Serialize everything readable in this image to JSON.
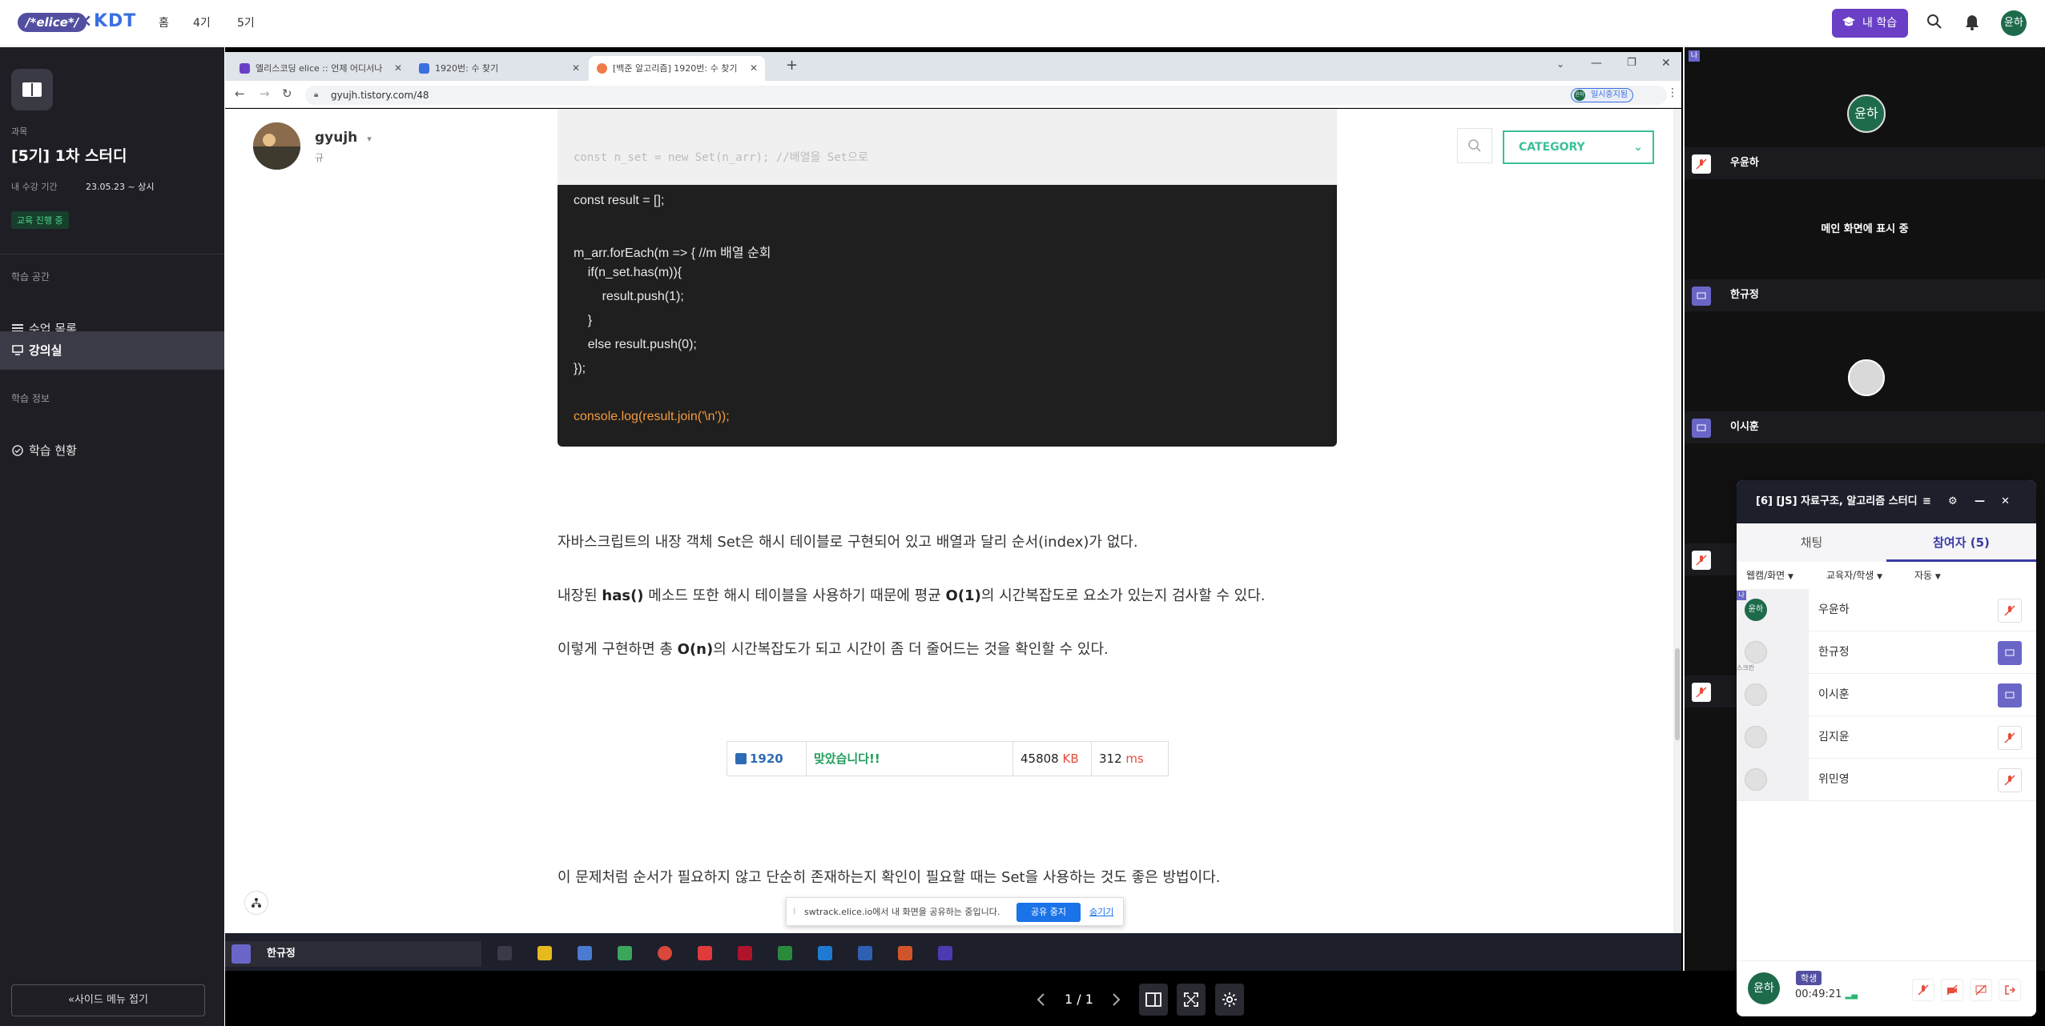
{
  "topbar": {
    "logo_text": "/*elice*/",
    "logo_x": "×",
    "logo_kdt": "KDT",
    "nav": [
      "홈",
      "4기",
      "5기"
    ],
    "my_learning": "내 학습",
    "avatar": "윤하"
  },
  "sidebar": {
    "course_label": "과목",
    "course_title": "[5기] 1차 스터디",
    "period_label": "내 수강 기간",
    "period_value": "23.05.23 ~ 상시",
    "status_badge": "교육 진행 중",
    "section1": "학습 공간",
    "items": [
      {
        "label": "수업 목록"
      },
      {
        "label": "강의실"
      }
    ],
    "section2": "학습 정보",
    "info_items": [
      {
        "label": "학습 현황"
      }
    ],
    "collapse": "«사이드 메뉴 접기"
  },
  "browser": {
    "tabs": [
      {
        "title": "엘리스코딩 elice :: 언제 어디서나",
        "color": "#6a3fc6"
      },
      {
        "title": "1920번: 수 찾기",
        "color": "#3a6fe0"
      },
      {
        "title": "[백준 알고리즘] 1920번: 수 찾기",
        "color": "#f07a4a"
      }
    ],
    "url": "gyujh.tistory.com/48",
    "paused_label": "일시중지됨",
    "profile_initials": "윤하"
  },
  "blog": {
    "author": "gyujh",
    "author_sub": "규",
    "category": "CATEGORY",
    "faded_lines": [
      "const n_set = new Set(n_arr); //배열을 Set으로"
    ],
    "code_lines": [
      "const result = [];",
      "",
      "m_arr.forEach(m => { //m 배열 순회",
      "    if(n_set.has(m)){",
      "        result.push(1);",
      "    }",
      "    else result.push(0);",
      "});",
      "",
      "console.log(result.join('\\n'));"
    ],
    "para1": "자바스크립트의 내장 객체 Set은 해시 테이블로 구현되어 있고 배열과 달리 순서(index)가 없다.",
    "para2_pre": "내장된 ",
    "para2_b1": "has()",
    "para2_mid": " 메소드 또한 해시 테이블을 사용하기 때문에 평균 ",
    "para2_b2": "O(1)",
    "para2_post": "의 시간복잡도로 요소가 있는지 검사할 수 있다.",
    "para3_pre": "이렇게 구현하면 총 ",
    "para3_b": "O(n)",
    "para3_post": "의 시간복잡도가 되고 시간이 좀 더 줄어드는 것을 확인할 수 있다.",
    "result": {
      "problem": "1920",
      "status": "맞았습니다!!",
      "memory": "45808",
      "memory_unit": "KB",
      "time": "312",
      "time_unit": "ms"
    },
    "para4": "이 문제처럼 순서가 필요하지 않고 단순히 존재하는지 확인이 필요할 때는 Set을 사용하는 것도 좋은 방법이다."
  },
  "share_bar": {
    "text": "swtrack.elice.io에서 내 화면을 공유하는 중입니다.",
    "stop": "공유 중지",
    "hide": "숨기기"
  },
  "shared_name_tag": "한규정",
  "controls": {
    "page": "1 / 1"
  },
  "video": {
    "me_tag": "나",
    "tiles": [
      {
        "name": "우윤하",
        "avatar": "윤하"
      },
      {
        "name": "한규정",
        "center_text": "메인 화면에 표시 중"
      },
      {
        "name": "이시훈"
      }
    ]
  },
  "panel": {
    "title": "[6] [JS] 자료구조, 알고리즘 스터디",
    "tabs": [
      "채팅",
      "참여자 (5)"
    ],
    "filters": [
      "웹캠/화면",
      "교육자/학생",
      "자동"
    ],
    "participants": [
      {
        "name": "우윤하",
        "avatar": "윤하",
        "me": "나"
      },
      {
        "name": "한규정",
        "tag": "스크린"
      },
      {
        "name": "이시훈"
      },
      {
        "name": "김지윤"
      },
      {
        "name": "위민영"
      }
    ],
    "footer": {
      "avatar": "윤하",
      "role": "학생",
      "timer": "00:49:21"
    }
  }
}
